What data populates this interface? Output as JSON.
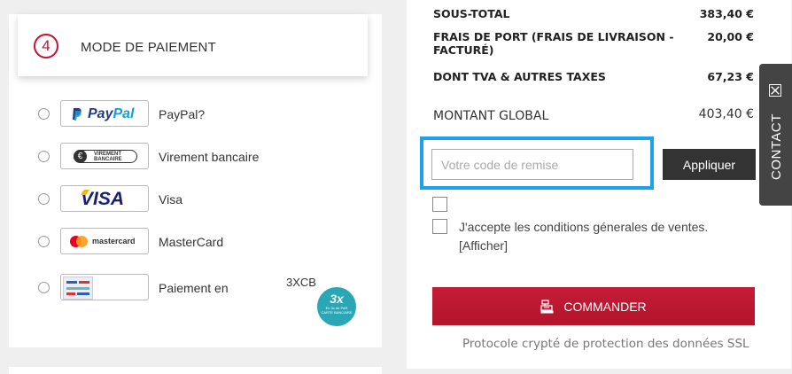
{
  "payment": {
    "step_number": "4",
    "title": "MODE DE PAIEMENT",
    "methods": [
      {
        "id": "paypal",
        "label": "PayPal?",
        "logo_text_a": "Pay",
        "logo_text_b": "Pal"
      },
      {
        "id": "virement",
        "label": "Virement bancaire",
        "logo_text_line1": "VIREMENT",
        "logo_text_line2": "BANCAIRE"
      },
      {
        "id": "visa",
        "label": "Visa",
        "logo_text": "VISA"
      },
      {
        "id": "mastercard",
        "label": "MasterCard",
        "logo_text": "mastercard"
      },
      {
        "id": "3xcb",
        "label": "Paiement en",
        "extra": "3XCB",
        "badge_big": "3x",
        "badge_small": "En 3x de PAR CARTE BANCAIRE"
      }
    ]
  },
  "summary": {
    "rows": [
      {
        "label": "SOUS-TOTAL",
        "value": "383,40 €"
      },
      {
        "label": "FRAIS DE PORT (FRAIS DE LIVRAISON - FACTURÉ)",
        "value": "20,00 €"
      },
      {
        "label": "DONT TVA & AUTRES TAXES",
        "value": "67,23 €"
      }
    ],
    "total_label": "MONTANT GLOBAL",
    "total_value": "403,40 €",
    "coupon_placeholder": "Votre code de remise",
    "apply_label": "Appliquer",
    "cgv_text": "J'accepte les conditions génerales de ventes. [Afficher]",
    "order_label": "COMMANDER",
    "ssl_text": "Protocole crypté de protection des données SSL"
  },
  "contact": {
    "label": "CONTACT",
    "close_glyph": "✕"
  },
  "colors": {
    "accent_red": "#c4122f",
    "highlight_blue": "#1aa3e8",
    "dark_button": "#333333",
    "badge_teal": "#2aa6b5"
  }
}
